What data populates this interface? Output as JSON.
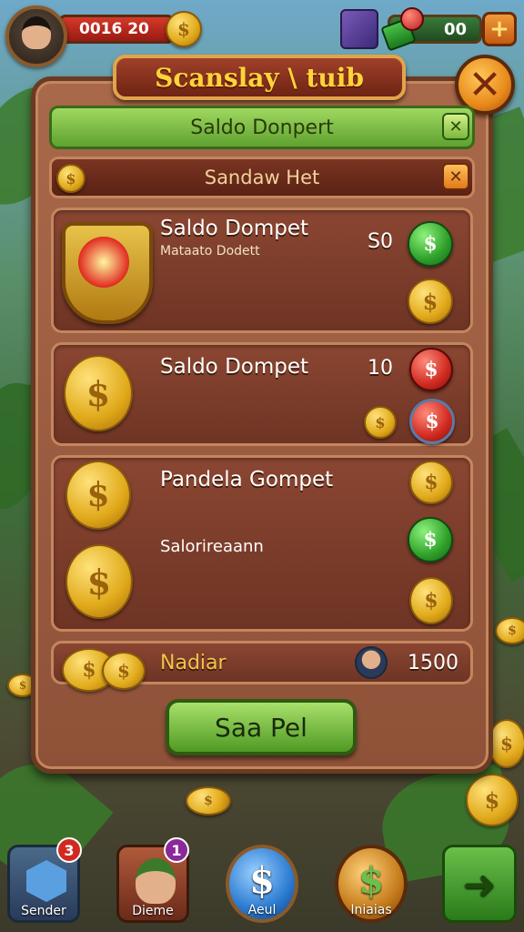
{
  "hud": {
    "coins_value": "0016 20",
    "gems_value": "00",
    "plus_label": "+"
  },
  "panel": {
    "title": "Scanslay \\ tuib",
    "close_label": "✕",
    "tab_green": {
      "label": "Saldo Donpert",
      "close": "✕"
    },
    "tab_red": {
      "label": "Sandaw Het",
      "close": "✕"
    }
  },
  "cards": [
    {
      "title": "Saldo Dompet",
      "subtitle": "Mataato Dodett",
      "value": "S0"
    },
    {
      "title": "Saldo Dompet",
      "value": "10"
    },
    {
      "title": "Pandela Gompet",
      "subtitle": "Salorireaann"
    }
  ],
  "bottom": {
    "label": "Nadiar",
    "value": "1500"
  },
  "save_button": "Saa Pel",
  "nav": [
    {
      "label": "Sender",
      "badge": "3"
    },
    {
      "label": "Dieme",
      "badge": "1"
    },
    {
      "label": "Aeul"
    },
    {
      "label": "Iniaias"
    },
    {
      "label": ""
    }
  ],
  "icons": {
    "coin": "$",
    "arrow": "➜"
  },
  "colors": {
    "panel": "#a9684a",
    "title_text": "#ffd43a",
    "accent_green": "#5ea230",
    "accent_red": "#d02a20"
  }
}
